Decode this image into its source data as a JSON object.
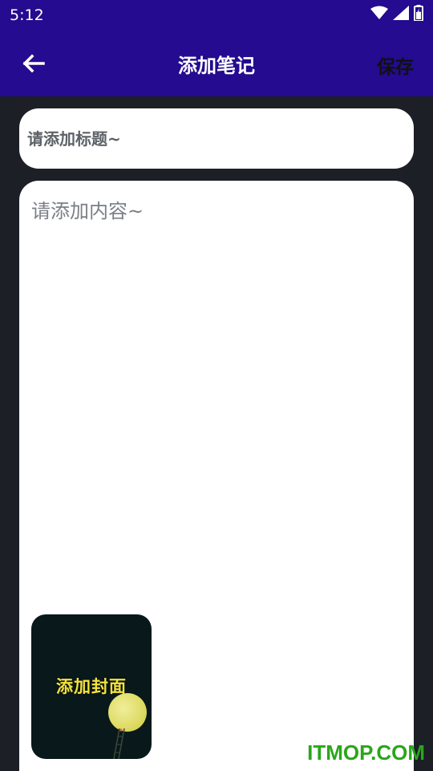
{
  "status_bar": {
    "time": "5:12",
    "icons": [
      "wifi-icon",
      "signal-icon",
      "battery-icon"
    ]
  },
  "app_bar": {
    "back_icon": "arrow-left-icon",
    "title": "添加笔记",
    "save_label": "保存"
  },
  "note": {
    "title_placeholder": "请添加标题~",
    "title_value": "",
    "content_placeholder": "请添加内容~",
    "content_value": ""
  },
  "cover": {
    "label": "添加封面"
  },
  "watermark": {
    "text": "ITMOP.COM"
  },
  "colors": {
    "app_bar": "#240b8f",
    "background": "#1c1f26",
    "card": "#ffffff",
    "cover_bg": "#09181a",
    "cover_text": "#f3e23c",
    "watermark": "#2aa61a"
  }
}
